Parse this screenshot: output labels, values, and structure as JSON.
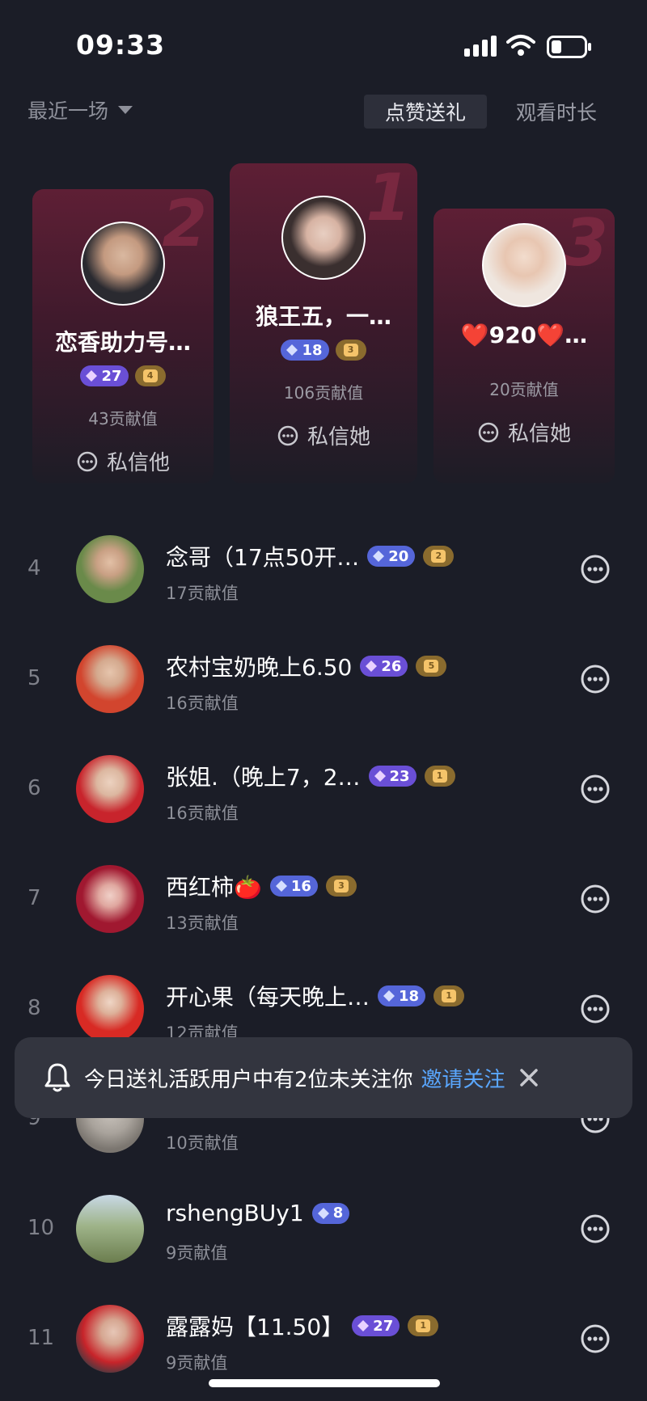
{
  "status_bar": {
    "time": "09:33"
  },
  "controls": {
    "range_label": "最近一场",
    "tab_likes": "点赞送礼",
    "tab_watch": "观看时长"
  },
  "podium": [
    {
      "rank": "2",
      "name": "恋香助力号…",
      "level": "27",
      "fan_level": "4",
      "contribution": "43贡献值",
      "dm": "私信他"
    },
    {
      "rank": "1",
      "name": "狼王五，一…",
      "level": "18",
      "fan_level": "3",
      "contribution": "106贡献值",
      "dm": "私信她"
    },
    {
      "rank": "3",
      "name": "❤️920❤️…",
      "contribution": "20贡献值",
      "dm": "私信她"
    }
  ],
  "list": [
    {
      "rank": "4",
      "name": "念哥（17点50开…",
      "level": "20",
      "fan_level": "2",
      "contribution": "17贡献值"
    },
    {
      "rank": "5",
      "name": "农村宝奶晚上6.50",
      "level": "26",
      "fan_level": "5",
      "contribution": "16贡献值"
    },
    {
      "rank": "6",
      "name": "张姐.（晚上7，2…",
      "level": "23",
      "fan_level": "1",
      "contribution": "16贡献值"
    },
    {
      "rank": "7",
      "name": "西红柿🍅",
      "level": "16",
      "fan_level": "3",
      "contribution": "13贡献值"
    },
    {
      "rank": "8",
      "name": "开心果（每天晚上…",
      "level": "18",
      "fan_level": "1",
      "contribution": "12贡献值"
    },
    {
      "rank": "9",
      "name": "",
      "contribution": "10贡献值"
    },
    {
      "rank": "10",
      "name": "rshengBUy1",
      "level": "8",
      "contribution": "9贡献值"
    },
    {
      "rank": "11",
      "name": "露露妈【11.50】",
      "level": "27",
      "fan_level": "1",
      "contribution": "9贡献值"
    }
  ],
  "toast": {
    "message": "今日送礼活跃用户中有2位未关注你",
    "action": "邀请关注"
  },
  "colors": {
    "background": "#1b1d27",
    "link": "#5aa7ff",
    "level_badge": "#5566d9",
    "fan_badge": "#8a6b2e"
  }
}
